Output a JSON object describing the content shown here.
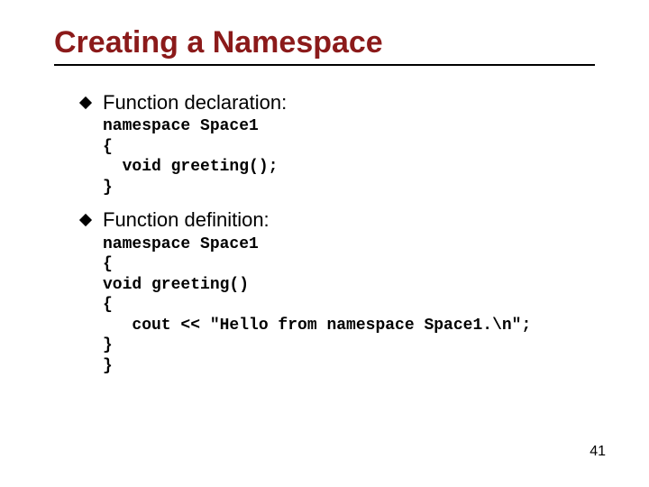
{
  "title": "Creating a Namespace",
  "bullets": [
    {
      "label": "Function declaration:"
    },
    {
      "label": "Function definition:"
    }
  ],
  "code": {
    "declaration": "namespace Space1\n{\n  void greeting();\n}",
    "definition": "namespace Space1\n{\nvoid greeting()\n{\n   cout << \"Hello from namespace Space1.\\n\";\n}\n}"
  },
  "page_number": "41"
}
